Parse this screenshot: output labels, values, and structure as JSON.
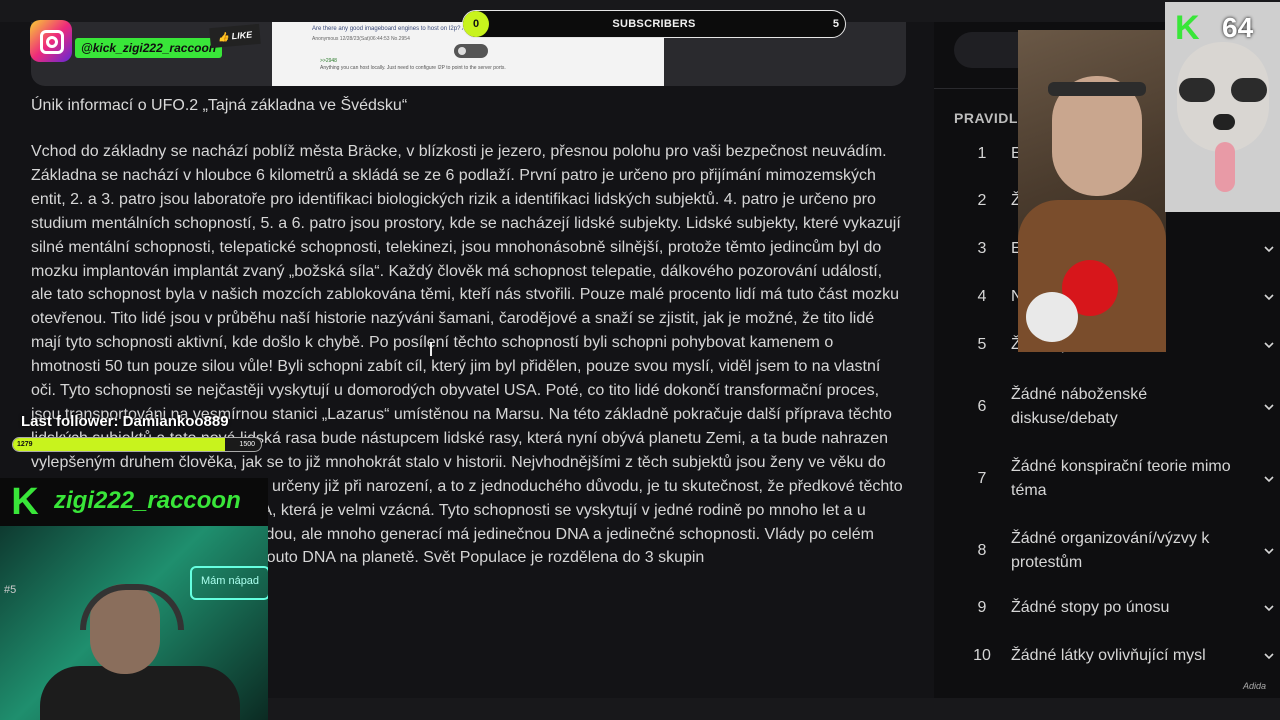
{
  "subscribers": {
    "current": "0",
    "label": "SUBSCRIBERS",
    "goal": "5",
    "progress": 0.0
  },
  "instagram": {
    "handle": "@kick_zigi222_raccoon",
    "like_label": "LIKE"
  },
  "embed": {
    "question": "Are there any good imageboard engines to host on I2p? Anonymous 12/28/23(Sat)06:44:53 No.2948 Quoted Link",
    "reply_meta": "Anonymous 12/28/23(Sat)06:44:53 No.2954",
    "reply_ref": ">>2948",
    "reply_text": "Anything you can host locally. Just need to configure I2P to point to the server ports."
  },
  "article": {
    "heading": "Únik informací o UFO.2 „Tajná základna ve Švédsku“",
    "text": "Vchod do základny se nachází poblíž města Bräcke, v blízkosti je jezero, přesnou polohu pro vaši bezpečnost neuvádím. Základna se nachází v hloubce 6 kilometrů a skládá se ze 6 podlaží. První patro je určeno pro přijímání mimozemských entit, 2. a 3. patro jsou laboratoře pro identifikaci biologických rizik a identifikaci lidských subjektů. 4. patro je určeno pro studium mentálních schopností, 5. a 6. patro jsou prostory, kde se nacházejí lidské subjekty. Lidské subjekty, které vykazují silné mentální schopnosti, telepatické schopnosti, telekinezi, jsou mnohonásobně silnější, protože těmto jedincům byl do mozku implantován implantát zvaný „božská síla“. Každý člověk má schopnost telepatie, dálkového pozorování událostí, ale tato schopnost byla v našich mozcích zablokována těmi, kteří nás stvořili. Pouze malé procento lidí má tuto část mozku otevřenou. Tito lidé jsou v průběhu naší historie nazýváni šamani, čarodějové a snaží se zjistit, jak je možné, že tito lidé mají tyto schopnosti aktivní, kde došlo k chybě. Po posílení těchto schopností byli schopni pohybovat kamenem o hmotnosti 50 tun pouze silou vůle! Byli schopni zabít cíl, který jim byl přidělen, pouze svou myslí, viděl jsem to na vlastní oči. Tyto schopnosti se nejčastěji vyskytují u domorodých obyvatel USA. Poté, co tito lidé dokončí transformační proces, jsou transportováni na vesmírnou stanici „Lazarus“ umístěnou na Marsu. Na této základně pokračuje další příprava těchto lidských subjektů a tato nová lidská rasa bude nástupcem lidské rasy, která nyní obývá planetu Zemi, a ta bude nahrazen vylepšeným druhem člověka, jak se to již mnohokrát stalo v historii. Nejvhodnějšími z těch subjektů jsou ženy ve věku do 20 let, které byly pro tento projekt určeny již při narození, a to z jednoduchého důvodu, je tu skutečnost, že předkové těchto žen již měli ve svých genech DNA, která je velmi vzácná. Tyto schopnosti se vyskytují v jedné rodině po mnoho let a u mnoha členů rodiny, nejsou náhodou, ale mnoho generací má jedinečnou DNA a jedinečné schopnosti. Vlády po celém světě vedou záznamy o lidech s touto DNA na planetě. Svět  Populace je rozdělena do 3 skupin"
  },
  "rules": {
    "title": "PRAVIDLA",
    "items": [
      {
        "num": "1",
        "text": "E"
      },
      {
        "num": "2",
        "text": "Ž"
      },
      {
        "num": "3",
        "text": "E"
      },
      {
        "num": "4",
        "text": "N"
      },
      {
        "num": "5",
        "text": "Žádná politika"
      },
      {
        "num": "6",
        "text": "Žádné náboženské diskuse/debaty"
      },
      {
        "num": "7",
        "text": "Žádné konspirační teorie mimo téma"
      },
      {
        "num": "8",
        "text": "Žádné organizování/výzvy k protestům"
      },
      {
        "num": "9",
        "text": "Žádné stopy po únosu"
      },
      {
        "num": "10",
        "text": "Žádné látky ovlivňující mysl"
      }
    ]
  },
  "stream": {
    "viewer_count": "64",
    "last_follower": "Last follower: Damiankoo889",
    "follower_goal": {
      "current": "1279",
      "goal": "1500",
      "progress": 0.853
    },
    "streamer_name": "zigi222_raccoon",
    "neon_sign": "Mám nápad",
    "room_tag": "#5"
  },
  "signature": "Adida",
  "colors": {
    "accent_green": "#39e639",
    "bar_lime": "#c8f31d",
    "bg": "#131316",
    "sidebar": "#0e0e10"
  },
  "icons": [
    "instagram-icon",
    "kick-logo-icon",
    "chevron-down-icon",
    "thumb-up-icon",
    "text-cursor-icon"
  ]
}
